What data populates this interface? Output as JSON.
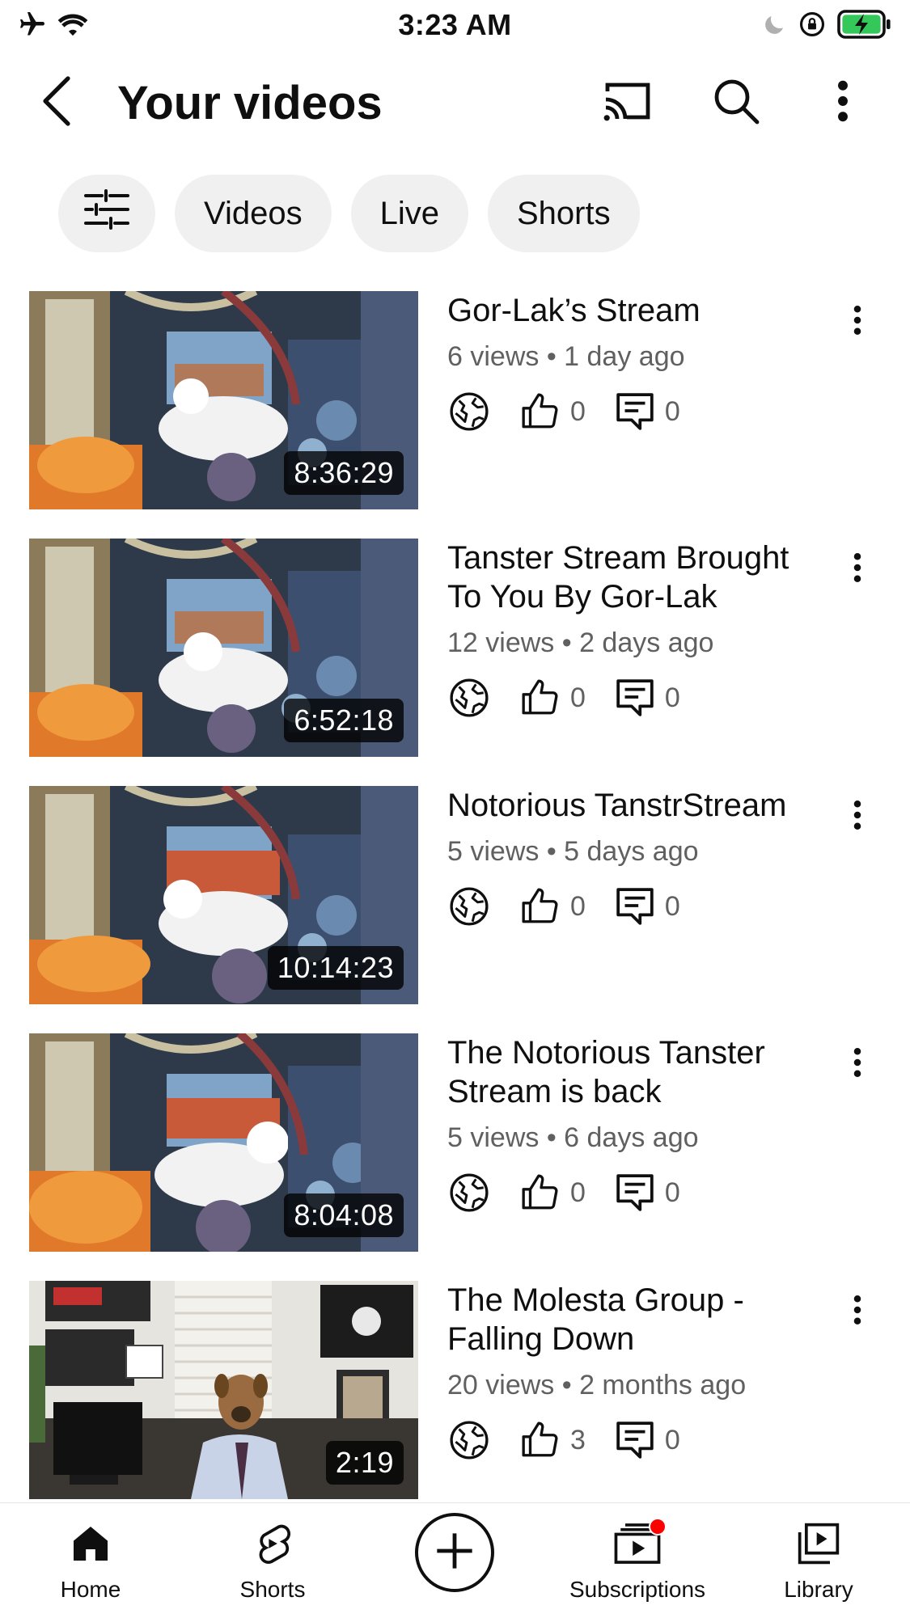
{
  "status_bar": {
    "time": "3:23 AM"
  },
  "header": {
    "title": "Your videos"
  },
  "chips": [
    "Videos",
    "Live",
    "Shorts"
  ],
  "videos": [
    {
      "title": "Gor-Lak’s Stream",
      "meta": "6 views • 1 day ago",
      "duration": "8:36:29",
      "likes": "0",
      "comments": "0"
    },
    {
      "title": "Tanster Stream Brought To You By Gor-Lak",
      "meta": "12 views • 2 days ago",
      "duration": "6:52:18",
      "likes": "0",
      "comments": "0"
    },
    {
      "title": "Notorious TanstrStream",
      "meta": "5 views • 5 days ago",
      "duration": "10:14:23",
      "likes": "0",
      "comments": "0"
    },
    {
      "title": "The Notorious Tanster Stream is back",
      "meta": "5 views • 6 days ago",
      "duration": "8:04:08",
      "likes": "0",
      "comments": "0"
    },
    {
      "title": "The Molesta Group - Falling Down",
      "meta": "20 views • 2 months ago",
      "duration": "2:19",
      "likes": "3",
      "comments": "0"
    }
  ],
  "bottom_nav": {
    "home": "Home",
    "shorts": "Shorts",
    "subscriptions": "Subscriptions",
    "library": "Library"
  },
  "colors": {
    "text_primary": "#0f0f0f",
    "text_secondary": "#606060",
    "chip_bg": "#f0f0f0",
    "battery_green": "#34c759",
    "notification_red": "#ff0000"
  },
  "icons": {
    "status_left": [
      "airplane-icon",
      "wifi-icon"
    ],
    "status_right": [
      "moon-icon",
      "rotation-lock-icon",
      "battery-charging-icon"
    ],
    "header": [
      "back-icon",
      "cast-icon",
      "search-icon",
      "more-vert-icon"
    ],
    "chip_filter": "sliders-icon",
    "row": [
      "globe-icon",
      "thumbs-up-icon",
      "comment-icon",
      "more-vert-icon"
    ],
    "nav": [
      "home-icon",
      "shorts-icon",
      "create-plus-icon",
      "subscriptions-icon",
      "library-icon"
    ]
  }
}
